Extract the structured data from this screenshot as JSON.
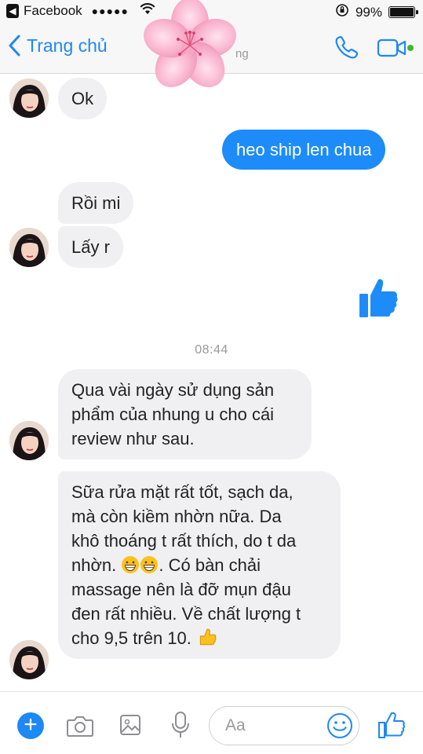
{
  "status_bar": {
    "back_app_label": "Facebook",
    "signal": "●●●●●",
    "battery_text": "99%",
    "battery_level": 0.99
  },
  "header": {
    "back_label": "Trang chủ",
    "subtitle_fragment": "ng"
  },
  "messages": [
    {
      "sender": "contact",
      "text": "Ok"
    },
    {
      "sender": "me",
      "text": "heo ship len chua"
    },
    {
      "sender": "contact",
      "text": "Rồi mi"
    },
    {
      "sender": "contact",
      "text": "Lấy r"
    },
    {
      "sender": "me",
      "type": "sticker",
      "icon": "thumbs-up-icon"
    },
    {
      "type": "timestamp",
      "text": "08:44"
    },
    {
      "sender": "contact",
      "lines": [
        "Qua vài ngày sử dụng sản",
        "phẩm của nhung u cho cái",
        "review như sau."
      ]
    },
    {
      "sender": "contact",
      "lines": [
        "Sữa rửa mặt rất tốt, sạch da,",
        "mà còn kiềm nhờn nữa. Da",
        "khô thoáng t rất thích, do t da",
        "nhờn.",
        ". Có bàn chải",
        "massage nên là đỡ mụn đậu",
        "đen rất nhiều. Về chất lượng t",
        "cho 9,5 trên 10."
      ]
    }
  ],
  "composer": {
    "placeholder": "Aa"
  },
  "colors": {
    "accent": "#1e88f5",
    "outgoing_bubble": "#1d8cf8",
    "incoming_bubble": "#f0f0f2",
    "online": "#42b72a"
  }
}
